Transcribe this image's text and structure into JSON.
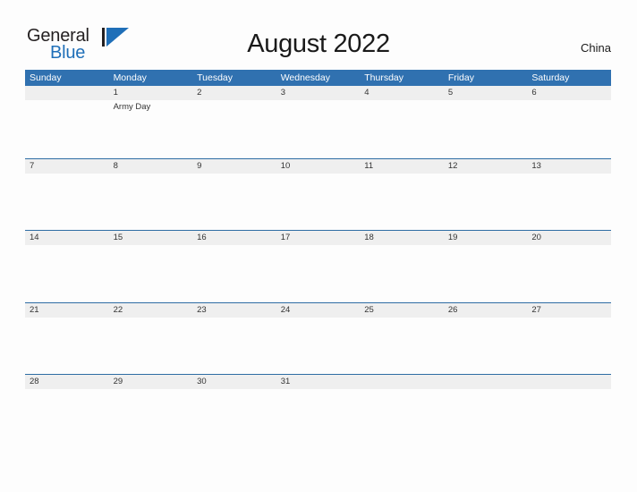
{
  "brand": {
    "line1": "General",
    "line2": "Blue",
    "triangle_color": "#1f6fb8"
  },
  "header": {
    "title": "August 2022",
    "region": "China",
    "accent_color": "#3071b0",
    "row_divider_color": "#2e6da4",
    "date_band_color": "#efefef"
  },
  "weekdays": [
    "Sunday",
    "Monday",
    "Tuesday",
    "Wednesday",
    "Thursday",
    "Friday",
    "Saturday"
  ],
  "weeks": [
    {
      "days": [
        {
          "date": "",
          "events": []
        },
        {
          "date": "1",
          "events": [
            "Army Day"
          ]
        },
        {
          "date": "2",
          "events": []
        },
        {
          "date": "3",
          "events": []
        },
        {
          "date": "4",
          "events": []
        },
        {
          "date": "5",
          "events": []
        },
        {
          "date": "6",
          "events": []
        }
      ]
    },
    {
      "days": [
        {
          "date": "7",
          "events": []
        },
        {
          "date": "8",
          "events": []
        },
        {
          "date": "9",
          "events": []
        },
        {
          "date": "10",
          "events": []
        },
        {
          "date": "11",
          "events": []
        },
        {
          "date": "12",
          "events": []
        },
        {
          "date": "13",
          "events": []
        }
      ]
    },
    {
      "days": [
        {
          "date": "14",
          "events": []
        },
        {
          "date": "15",
          "events": []
        },
        {
          "date": "16",
          "events": []
        },
        {
          "date": "17",
          "events": []
        },
        {
          "date": "18",
          "events": []
        },
        {
          "date": "19",
          "events": []
        },
        {
          "date": "20",
          "events": []
        }
      ]
    },
    {
      "days": [
        {
          "date": "21",
          "events": []
        },
        {
          "date": "22",
          "events": []
        },
        {
          "date": "23",
          "events": []
        },
        {
          "date": "24",
          "events": []
        },
        {
          "date": "25",
          "events": []
        },
        {
          "date": "26",
          "events": []
        },
        {
          "date": "27",
          "events": []
        }
      ]
    },
    {
      "days": [
        {
          "date": "28",
          "events": []
        },
        {
          "date": "29",
          "events": []
        },
        {
          "date": "30",
          "events": []
        },
        {
          "date": "31",
          "events": []
        },
        {
          "date": "",
          "events": []
        },
        {
          "date": "",
          "events": []
        },
        {
          "date": "",
          "events": []
        }
      ]
    }
  ]
}
